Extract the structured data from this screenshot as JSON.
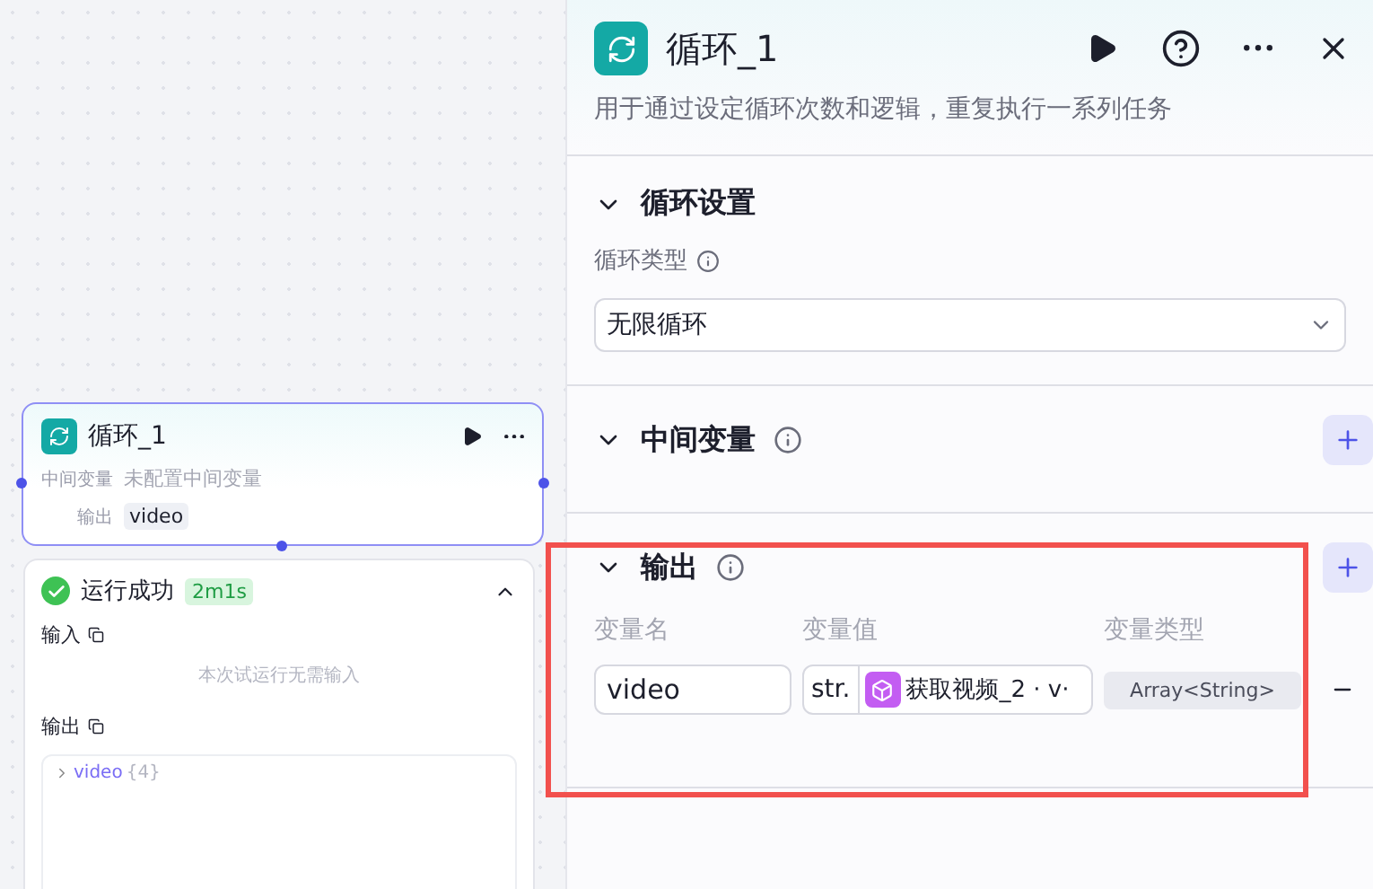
{
  "node": {
    "title": "循环_1",
    "fields": [
      {
        "label": "中间变量",
        "value": "未配置中间变量"
      }
    ],
    "output_label": "输出",
    "output_chip": "video"
  },
  "run": {
    "status": "运行成功",
    "duration": "2m1s",
    "expanded": true,
    "input_label": "输入",
    "input_empty": "本次试运行无需输入",
    "output_label": "输出",
    "output_tree": [
      {
        "name": "video",
        "count": "{4}",
        "expanded": false
      }
    ]
  },
  "panel": {
    "title": "循环_1",
    "description": "用于通过设定循环次数和逻辑，重复执行一系列任务",
    "sections": [
      {
        "kind": "settings",
        "title": "循环设置",
        "expanded": true,
        "has_info": false,
        "has_add": false,
        "field_label": "循环类型",
        "select_value": "无限循环"
      },
      {
        "kind": "variables",
        "title": "中间变量",
        "expanded": true,
        "has_info": true,
        "has_add": true
      },
      {
        "kind": "outputs",
        "title": "输出",
        "expanded": true,
        "has_info": true,
        "has_add": true,
        "highlighted": true,
        "columns": [
          "变量名",
          "变量值",
          "变量类型"
        ],
        "rows": [
          {
            "name": "video",
            "value_prefix": "str.",
            "value_ref": "获取视频_2 · v·",
            "type": "Array<String>"
          }
        ]
      }
    ]
  }
}
